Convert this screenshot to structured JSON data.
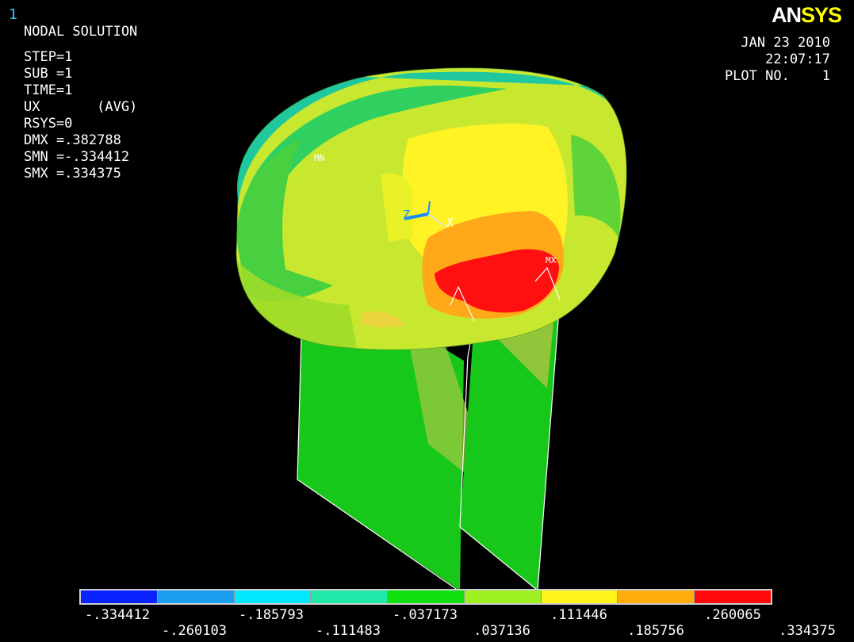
{
  "window_number": "1",
  "logo": {
    "part1": "AN",
    "part2": "SYS"
  },
  "info": {
    "title": "NODAL SOLUTION",
    "step": "STEP=1",
    "sub": "SUB =1",
    "time": "TIME=1",
    "component": "UX       (AVG)",
    "rsys": "RSYS=0",
    "dmx": "DMX =.382788",
    "smn": "SMN =-.334412",
    "smx": "SMX =.334375"
  },
  "plot_meta": {
    "date": "JAN 23 2010",
    "time": "22:07:17",
    "plot_no": "PLOT NO.    1"
  },
  "markers": {
    "min": "MN",
    "max": "MX",
    "axis_z": "Z",
    "axis_x": "X"
  },
  "legend": {
    "colors": [
      "#0a22ff",
      "#1c9ff0",
      "#00e9ff",
      "#1fe8a8",
      "#10e010",
      "#9ef020",
      "#fff51a",
      "#ffad0a",
      "#ff0a0a"
    ],
    "labels_top": [
      "-.334412",
      "-.185793",
      "-.037173",
      ".111446",
      ".260065"
    ],
    "labels_bottom": [
      "-.260103",
      "-.111483",
      ".037136",
      ".185756",
      ".334375"
    ]
  }
}
